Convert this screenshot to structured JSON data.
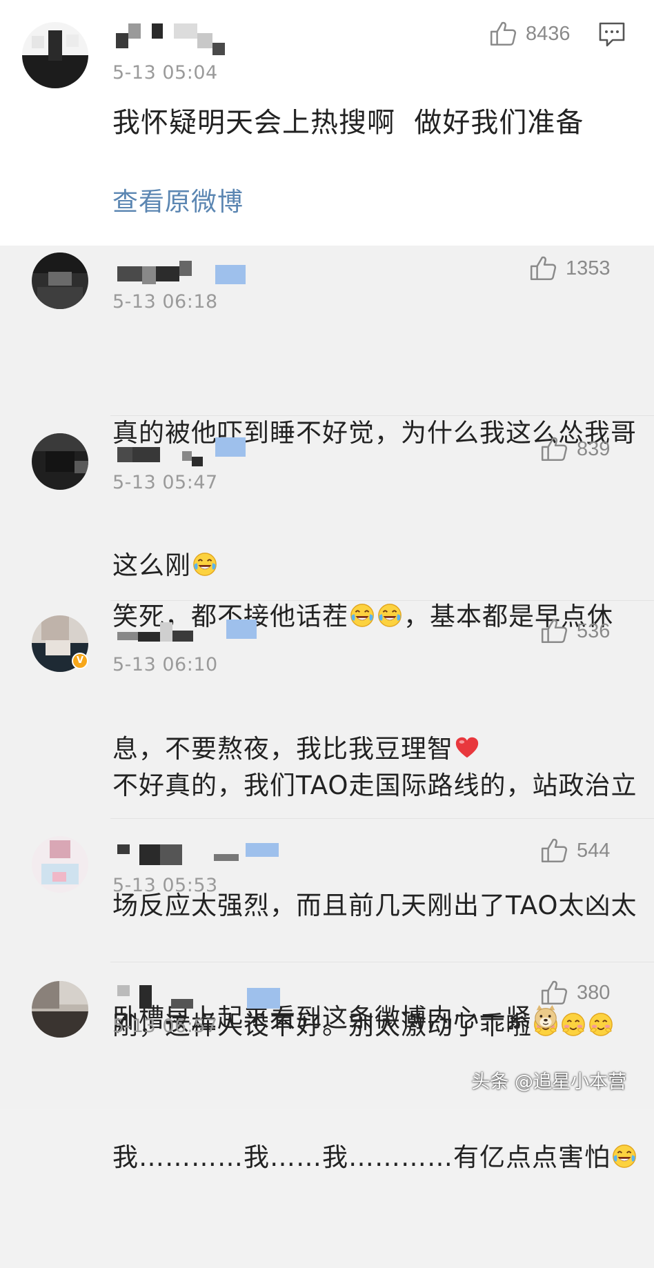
{
  "top_comment": {
    "time": "5-13 05:04",
    "likes": "8436",
    "text": "我怀疑明天会上热搜啊  做好我们准备",
    "view_original": "查看原微博"
  },
  "replies": [
    {
      "time": "5-13 06:18",
      "likes": "1353",
      "line1": "真的被他吓到睡不好觉，为什么我这么怂我哥",
      "line2": "这么刚"
    },
    {
      "time": "5-13 05:47",
      "likes": "839",
      "line1a": "笑死，都不接他话茬",
      "line1b": "，基本都是早点休",
      "line2": "息，不要熬夜，我比我豆理智"
    },
    {
      "time": "5-13 06:10",
      "likes": "536",
      "verified": "V",
      "line1": "不好真的，我们TAO走国际路线的，站政治立",
      "line2": "场反应太强烈，而且前几天刚出了TAO太凶太",
      "line3": "刚，这样人设不好。别太激动了乖啦"
    },
    {
      "time": "5-13 05:53",
      "likes": "544",
      "line1": "卧槽早上起来看到这条微博内心一紧"
    },
    {
      "time": "5-13 06:57",
      "likes": "380",
      "line1": "我…………我……我…………有亿点点害怕"
    }
  ],
  "watermark": "头条 @追星小本营",
  "icons": {
    "like": "thumbs-up-icon",
    "comment": "comment-bubble-icon",
    "laugh_cry": "laughing-tears-emoji",
    "heart": "red-heart-emoji",
    "blush": "blushing-emoji",
    "doge": "doge-emoji"
  },
  "colors": {
    "link": "#5b86b2",
    "time": "#9a9a9a",
    "like_count": "#8a8a8a",
    "vip_blue": "#9ec0ec",
    "heart": "#e8383d"
  }
}
